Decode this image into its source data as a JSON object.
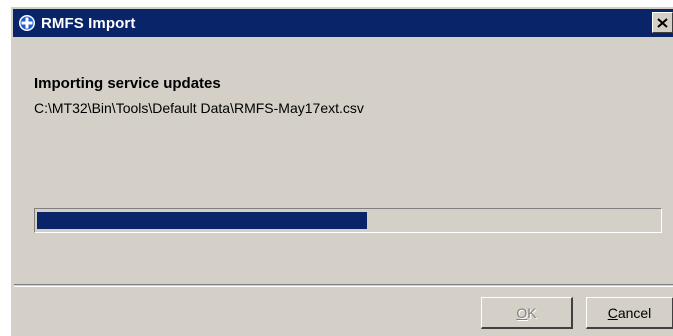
{
  "window": {
    "title": "RMFS Import",
    "close_glyph": "×"
  },
  "content": {
    "heading": "Importing service updates",
    "file_path": "C:\\MT32\\Bin\\Tools\\Default Data\\RMFS-May17ext.csv"
  },
  "progress": {
    "fraction": 0.53
  },
  "buttons": {
    "ok": {
      "mnemonic": "O",
      "rest": "K",
      "enabled": false
    },
    "cancel": {
      "mnemonic": "C",
      "rest": "ancel",
      "enabled": true
    }
  },
  "colors": {
    "titlebar": "#0a246a",
    "progress_fill": "#0a246a",
    "face": "#d4d0c8"
  },
  "icons": {
    "app": "rmfs-app-icon",
    "close": "close-icon"
  }
}
